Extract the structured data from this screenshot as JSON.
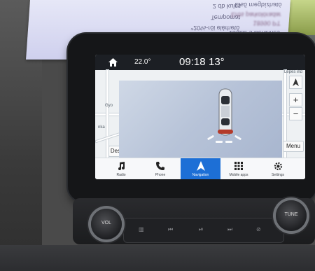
{
  "status_bar": {
    "inside_temp": "22.0°",
    "time": "09:18",
    "outside_temp": "13°"
  },
  "map": {
    "labels": [
      "Gyo",
      "nka",
      "Lepes ind"
    ],
    "destination_button": "Des",
    "menu_button": "Menu",
    "zoom_in": "+",
    "zoom_out": "−"
  },
  "nav_bar": {
    "items": [
      {
        "label": "Radio",
        "icon": "music-note-icon"
      },
      {
        "label": "Phone",
        "icon": "phone-icon"
      },
      {
        "label": "Navigation",
        "icon": "navigation-arrow-icon",
        "active": true
      },
      {
        "label": "Mobile apps",
        "icon": "apps-grid-icon"
      },
      {
        "label": "Settings",
        "icon": "gear-icon"
      }
    ],
    "accent_color": "#1d6fd6"
  },
  "controls": {
    "vol_label": "VOL",
    "tune_label": "TUNE"
  },
  "paper_sign": {
    "left_lines": [
      "2 db kulcs",
      "Tempomat",
      "*20%-ról elérhető"
    ],
    "right_lines": [
      "Első megbízható",
      "Erős parkolóradar",
      "18990 PT",
      "135LE-s Benzines"
    ]
  }
}
